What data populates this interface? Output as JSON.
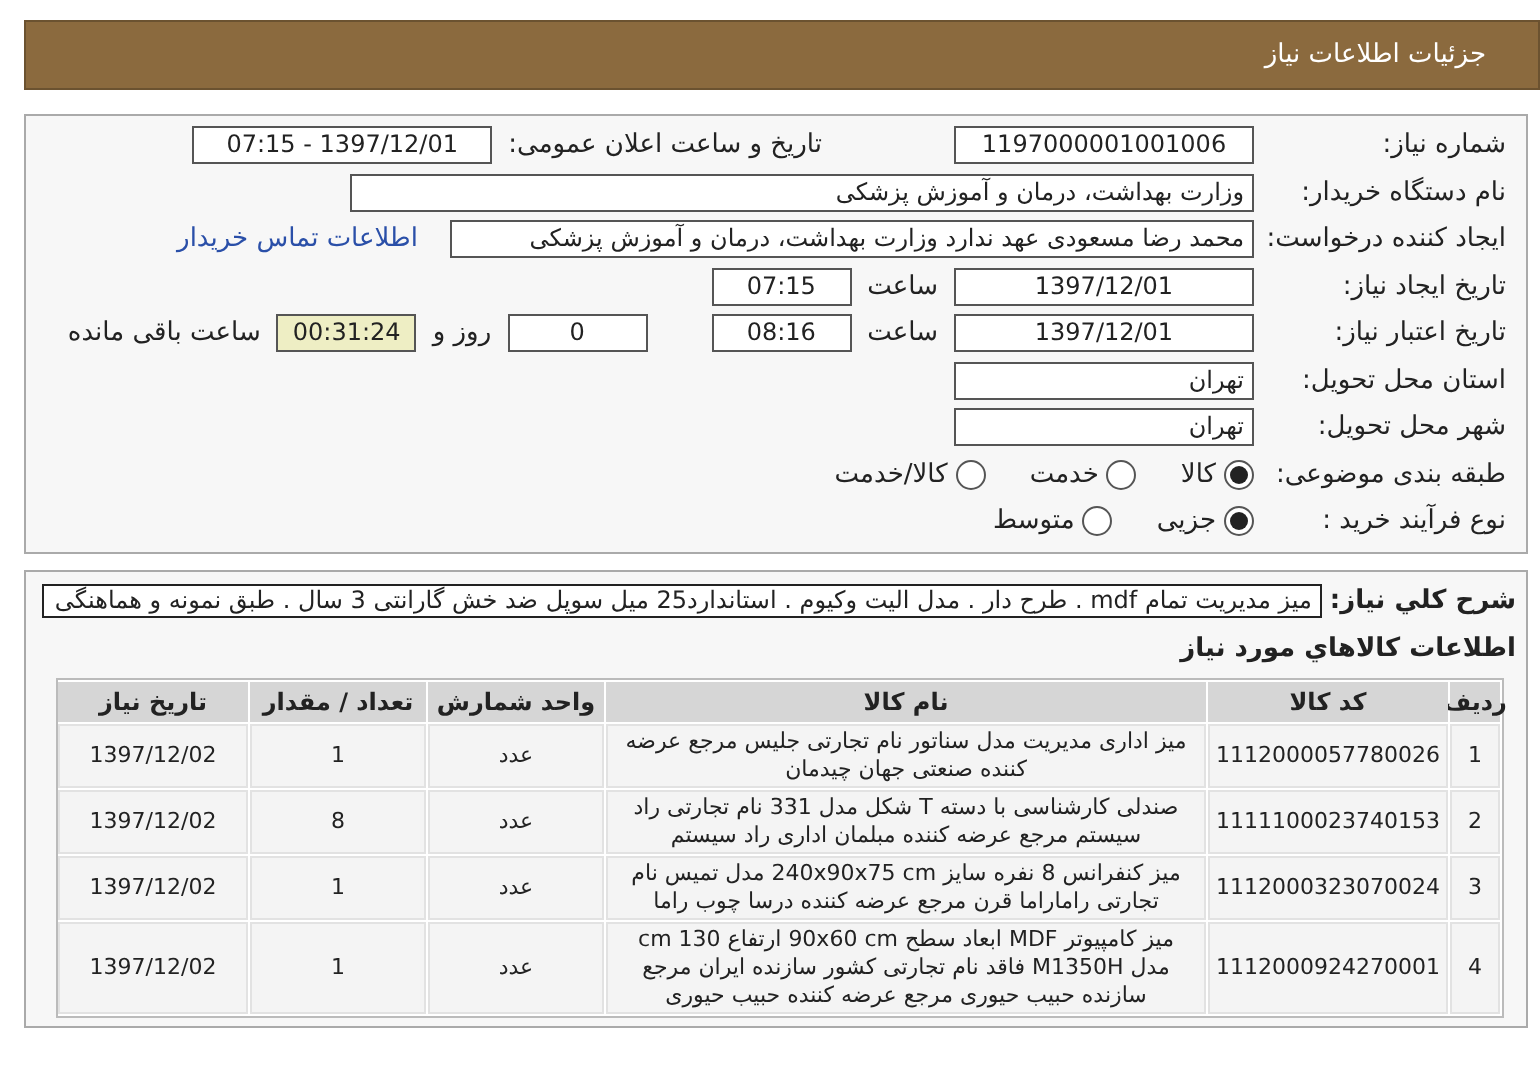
{
  "header": {
    "title": "جزئیات اطلاعات نیاز"
  },
  "need_number": {
    "label": "شماره نیاز:",
    "value": "1197000001001006"
  },
  "announce": {
    "label": "تاریخ و ساعت اعلان عمومی:",
    "value": "1397/12/01 - 07:15"
  },
  "buyer_org": {
    "label": "نام دستگاه خریدار:",
    "value": "وزارت بهداشت، درمان و آموزش پزشکی"
  },
  "requester": {
    "label": "ایجاد کننده درخواست:",
    "value": "محمد رضا مسعودی عهد ندارد وزارت بهداشت، درمان و آموزش پزشکی",
    "link": "اطلاعات تماس خریدار"
  },
  "created": {
    "label": "تاریخ ایجاد نیاز:",
    "date": "1397/12/01",
    "time_label": "ساعت",
    "time": "07:15"
  },
  "validity": {
    "label": "تاریخ اعتبار نیاز:",
    "date": "1397/12/01",
    "time_label": "ساعت",
    "time": "08:16",
    "days": "0",
    "days_label": "روز و",
    "remaining": "00:31:24",
    "remaining_label": "ساعت باقی مانده"
  },
  "province": {
    "label": "استان محل تحویل:",
    "value": "تهران"
  },
  "city": {
    "label": "شهر محل تحویل:",
    "value": "تهران"
  },
  "category": {
    "label": "طبقه بندی موضوعی:",
    "options": [
      {
        "label": "کالا",
        "selected": true
      },
      {
        "label": "خدمت",
        "selected": false
      },
      {
        "label": "کالا/خدمت",
        "selected": false
      }
    ]
  },
  "process": {
    "label": "نوع فرآیند خرید :",
    "options": [
      {
        "label": "جزیی",
        "selected": true
      },
      {
        "label": "متوسط",
        "selected": false
      }
    ]
  },
  "description": {
    "label": "شرح کلي نياز:",
    "value": "میز مدیریت تمام mdf . طرح دار . مدل الیت وکیوم . استاندارد25 میل سوپل ضد خش گارانتی 3 سال . طبق نمونه و هماهنگی"
  },
  "items_title": "اطلاعات کالاهاي مورد نياز",
  "table": {
    "columns": [
      "ردیف",
      "کد کالا",
      "نام کالا",
      "واحد شمارش",
      "تعداد / مقدار",
      "تاریخ نیاز"
    ],
    "rows": [
      [
        "1",
        "1112000057780026",
        "میز اداری مدیریت مدل سناتور نام تجارتی جلیس مرجع عرضه کننده صنعتی جهان چیدمان",
        "عدد",
        "1",
        "1397/12/02"
      ],
      [
        "2",
        "1111100023740153",
        "صندلی کارشناسی با دسته T شکل مدل 331 نام تجارتی راد سیستم مرجع عرضه کننده مبلمان اداری راد سیستم",
        "عدد",
        "8",
        "1397/12/02"
      ],
      [
        "3",
        "1112000323070024",
        "میز کنفرانس 8 نفره سایز 240x90x75 cm مدل تمیس نام تجارتی راماراما قرن مرجع عرضه کننده درسا چوب راما",
        "عدد",
        "1",
        "1397/12/02"
      ],
      [
        "4",
        "1112000924270001",
        "میز کامپیوتر MDF ابعاد سطح 90x60 cm ارتفاع 130 cm مدل M1350H فاقد نام تجارتی کشور سازنده ایران مرجع سازنده حبیب حیوری مرجع عرضه کننده حبیب حیوری",
        "عدد",
        "1",
        "1397/12/02"
      ]
    ]
  }
}
